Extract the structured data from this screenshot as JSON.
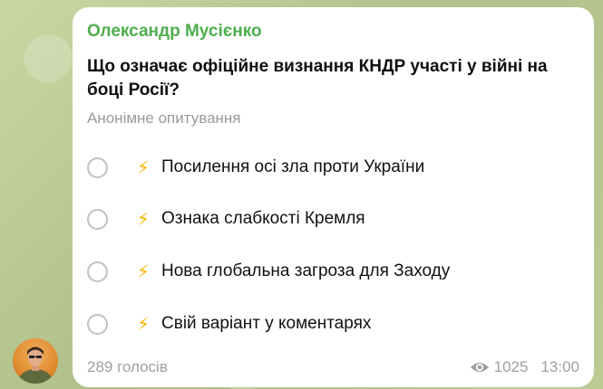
{
  "message": {
    "author": "Олександр Мусієнко",
    "question": "Що означає офіційне визнання КНДР участі у війні на боці Росії?",
    "poll_type": "Анонімне опитування",
    "options": [
      {
        "icon": "⚡",
        "label": "Посилення осі зла проти України"
      },
      {
        "icon": "⚡",
        "label": "Ознака слабкості Кремля"
      },
      {
        "icon": "⚡",
        "label": "Нова глобальна загроза для Заходу"
      },
      {
        "icon": "⚡",
        "label": "Свій варіант у коментарях"
      }
    ],
    "votes": "289 голосів",
    "views": "1025",
    "time": "13:00"
  },
  "icons": {
    "option_icon": "lightning-icon",
    "views_icon": "eye-icon",
    "radio_icon": "radio-unchecked-icon"
  },
  "colors": {
    "author": "#4fae4e",
    "bolt": "#f7b500",
    "muted": "#a0a0a0",
    "background": "#b9c896"
  }
}
